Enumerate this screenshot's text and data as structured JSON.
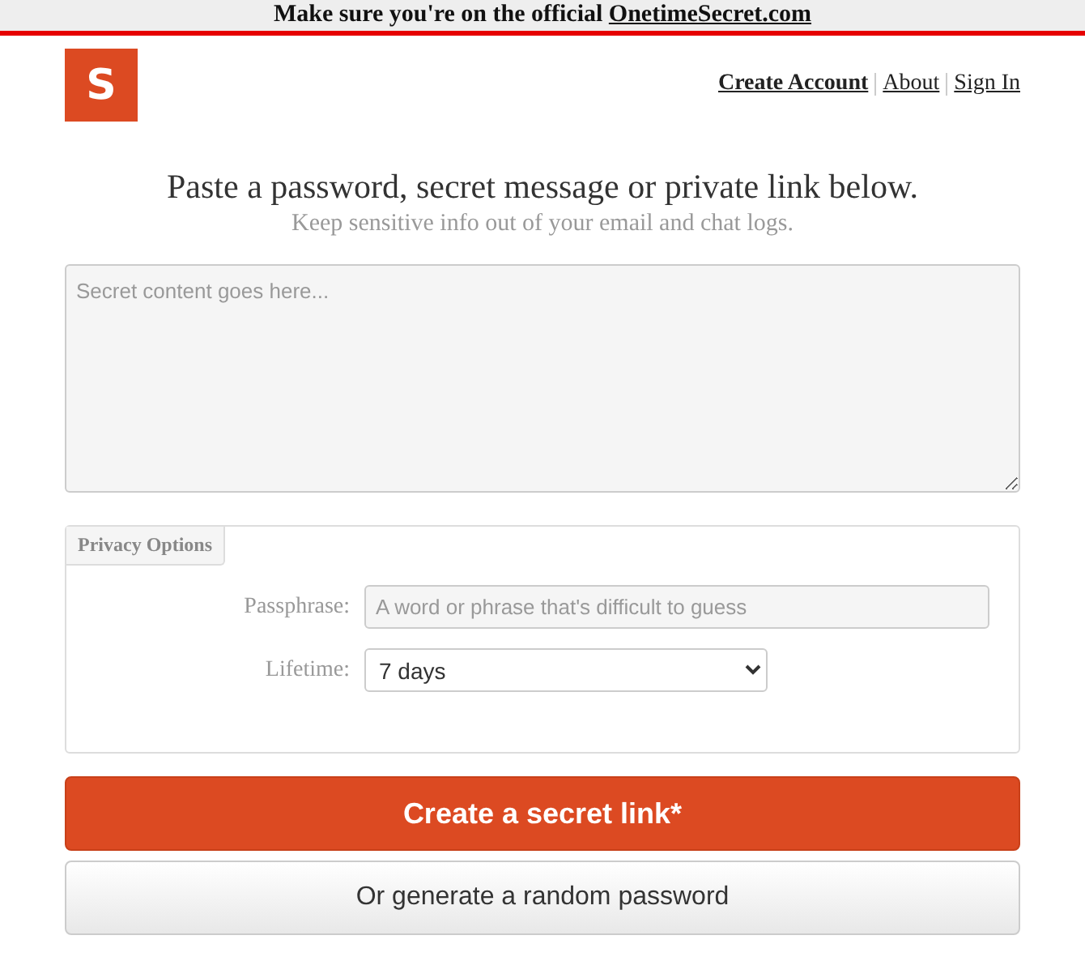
{
  "banner": {
    "text": "Make sure you're on the official ",
    "link": "OnetimeSecret.com"
  },
  "logo": {
    "letter": "S"
  },
  "nav": [
    {
      "label": "Create Account",
      "bold": true
    },
    {
      "label": "About",
      "bold": false
    },
    {
      "label": "Sign In",
      "bold": false
    }
  ],
  "heading": "Paste a password, secret message or private link below.",
  "subheading": "Keep sensitive info out of your email and chat logs.",
  "secret": {
    "placeholder": "Secret content goes here..."
  },
  "privacy_options": {
    "legend": "Privacy Options",
    "passphrase": {
      "label": "Passphrase:",
      "placeholder": "A word or phrase that's difficult to guess"
    },
    "lifetime": {
      "label": "Lifetime:",
      "value": "7 days"
    }
  },
  "buttons": [
    {
      "label": "Create a secret link*",
      "kind": "primary"
    },
    {
      "label": "Or generate a random password",
      "kind": "secondary"
    }
  ]
}
